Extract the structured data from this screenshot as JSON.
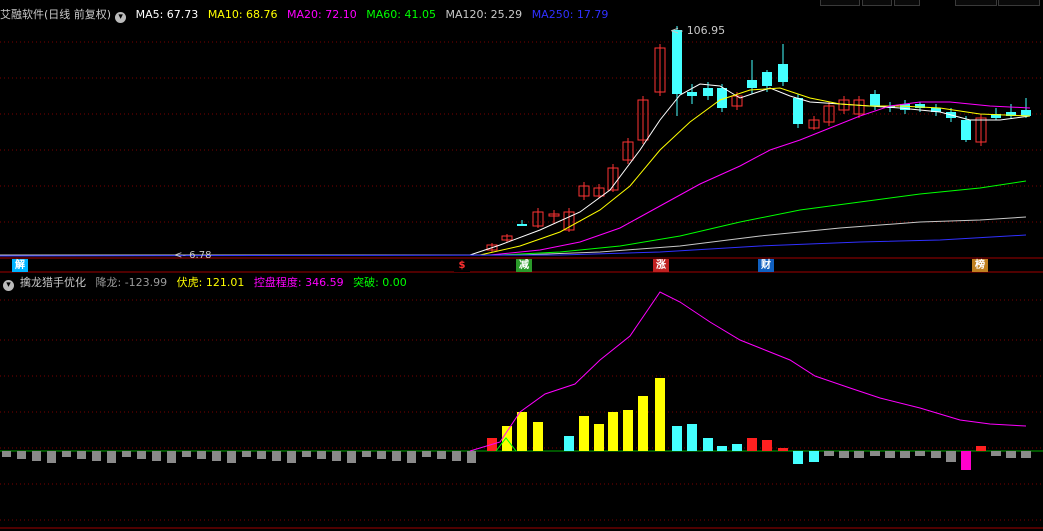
{
  "main_panel": {
    "title": "艾融软件(日线 前复权)",
    "ma_values": [
      {
        "label": "MA5: 67.73",
        "color": "#ffffff"
      },
      {
        "label": "MA10: 68.76",
        "color": "#ffff00"
      },
      {
        "label": "MA20: 72.10",
        "color": "#ff00ff"
      },
      {
        "label": "MA60: 41.05",
        "color": "#00ff00"
      },
      {
        "label": "MA120: 25.29",
        "color": "#c8c8c8"
      },
      {
        "label": "MA250: 17.79",
        "color": "#3030ff"
      }
    ],
    "high_label": "106.95",
    "low_label": "6.78",
    "markers": [
      {
        "text": "解",
        "bg": "#00b4ff",
        "fg": "#ffffff"
      },
      {
        "text": "$",
        "bg": "#000000",
        "fg": "#ff3030"
      },
      {
        "text": "减",
        "bg": "#2a9a2a",
        "fg": "#ffffff"
      },
      {
        "text": "涨",
        "bg": "#c02020",
        "fg": "#ffffff"
      },
      {
        "text": "财",
        "bg": "#1060c0",
        "fg": "#ffffff"
      },
      {
        "text": "榜",
        "bg": "#c08020",
        "fg": "#ffffff"
      }
    ]
  },
  "sub_panel": {
    "title": "擒龙猎手优化",
    "values": [
      {
        "label": "降龙: -123.99",
        "color": "#9a9a9a"
      },
      {
        "label": "伏虎: 121.01",
        "color": "#ffff00"
      },
      {
        "label": "控盘程度: 346.59",
        "color": "#ff00ff"
      },
      {
        "label": "突破: 0.00",
        "color": "#00ff00"
      }
    ]
  },
  "colors": {
    "up": "#ff3333",
    "down": "#44ffff",
    "grid": "#7a0000",
    "bg": "#000000"
  }
}
